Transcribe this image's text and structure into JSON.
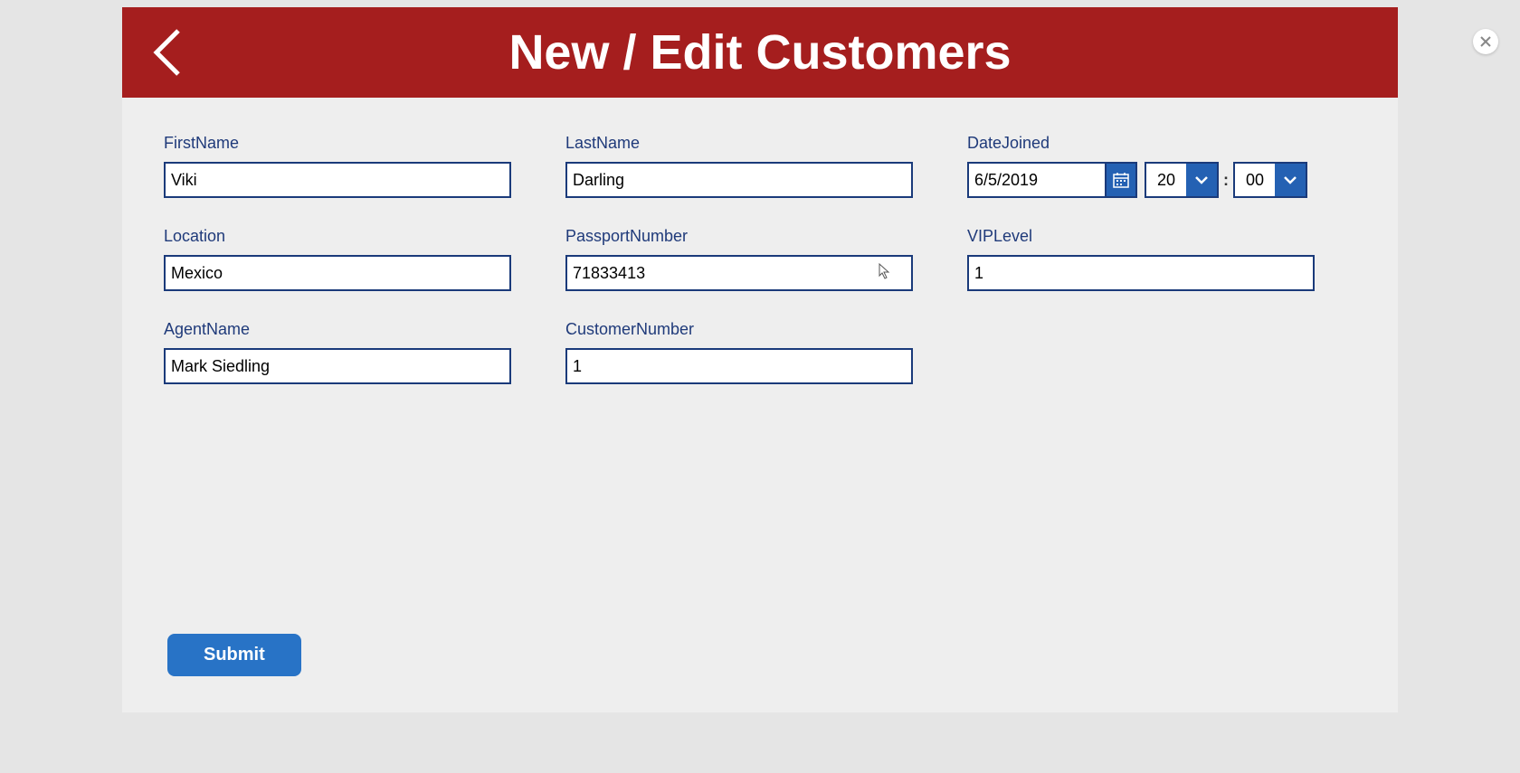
{
  "header": {
    "title": "New / Edit Customers"
  },
  "form": {
    "firstName": {
      "label": "FirstName",
      "value": "Viki"
    },
    "lastName": {
      "label": "LastName",
      "value": "Darling"
    },
    "dateJoined": {
      "label": "DateJoined",
      "date": "6/5/2019",
      "hour": "20",
      "minute": "00",
      "separator": ":"
    },
    "location": {
      "label": "Location",
      "value": "Mexico"
    },
    "passportNumber": {
      "label": "PassportNumber",
      "value": "71833413"
    },
    "vipLevel": {
      "label": "VIPLevel",
      "value": "1"
    },
    "agentName": {
      "label": "AgentName",
      "value": "Mark Siedling"
    },
    "customerNumber": {
      "label": "CustomerNumber",
      "value": "1"
    }
  },
  "buttons": {
    "submit": "Submit"
  },
  "colors": {
    "headerBg": "#a51e1e",
    "inputBorder": "#1a3a7a",
    "labelColor": "#1f3a7a",
    "buttonBg": "#2873c6",
    "accentBg": "#2461b3"
  }
}
